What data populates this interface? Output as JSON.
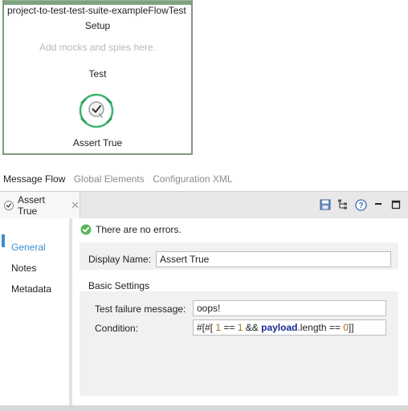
{
  "flow": {
    "title": "project-to-test-test-suite-exampleFlowTest",
    "setup_label": "Setup",
    "setup_hint": "Add mocks and spies here.",
    "test_label": "Test",
    "processor_label": "Assert True",
    "processor_icon": "assert-check-icon",
    "accent_color": "#3cb371"
  },
  "editor_tabs": [
    {
      "label": "Message Flow",
      "active": true
    },
    {
      "label": "Global Elements",
      "active": false
    },
    {
      "label": "Configuration XML",
      "active": false
    }
  ],
  "properties": {
    "tab_label": "Assert True",
    "tab_close": "✕",
    "tools": [
      "save-icon",
      "tree-icon",
      "help-icon",
      "minimize-icon",
      "maximize-icon"
    ],
    "nav": [
      {
        "label": "General",
        "active": true
      },
      {
        "label": "Notes",
        "active": false
      },
      {
        "label": "Metadata",
        "active": false
      }
    ],
    "status": "There are no errors.",
    "display_name_label": "Display Name:",
    "display_name_value": "Assert True",
    "basic_settings_title": "Basic Settings",
    "failure_message_label": "Test failure message:",
    "failure_message_value": "oops!",
    "condition_label": "Condition:",
    "condition_tokens": [
      {
        "text": "#[#[ ",
        "kind": "bracket"
      },
      {
        "text": "1",
        "kind": "num"
      },
      {
        "text": " == ",
        "kind": "op"
      },
      {
        "text": "1",
        "kind": "num"
      },
      {
        "text": " && ",
        "kind": "op"
      },
      {
        "text": "payload",
        "kind": "kw"
      },
      {
        "text": ".length == ",
        "kind": "prop"
      },
      {
        "text": "0",
        "kind": "num"
      },
      {
        "text": "]]",
        "kind": "bracket"
      }
    ]
  },
  "colors": {
    "link_blue": "#3d8fd1",
    "success_green": "#5cb85c",
    "number_color": "#a56a1a",
    "keyword_color": "#1b2c8f"
  }
}
